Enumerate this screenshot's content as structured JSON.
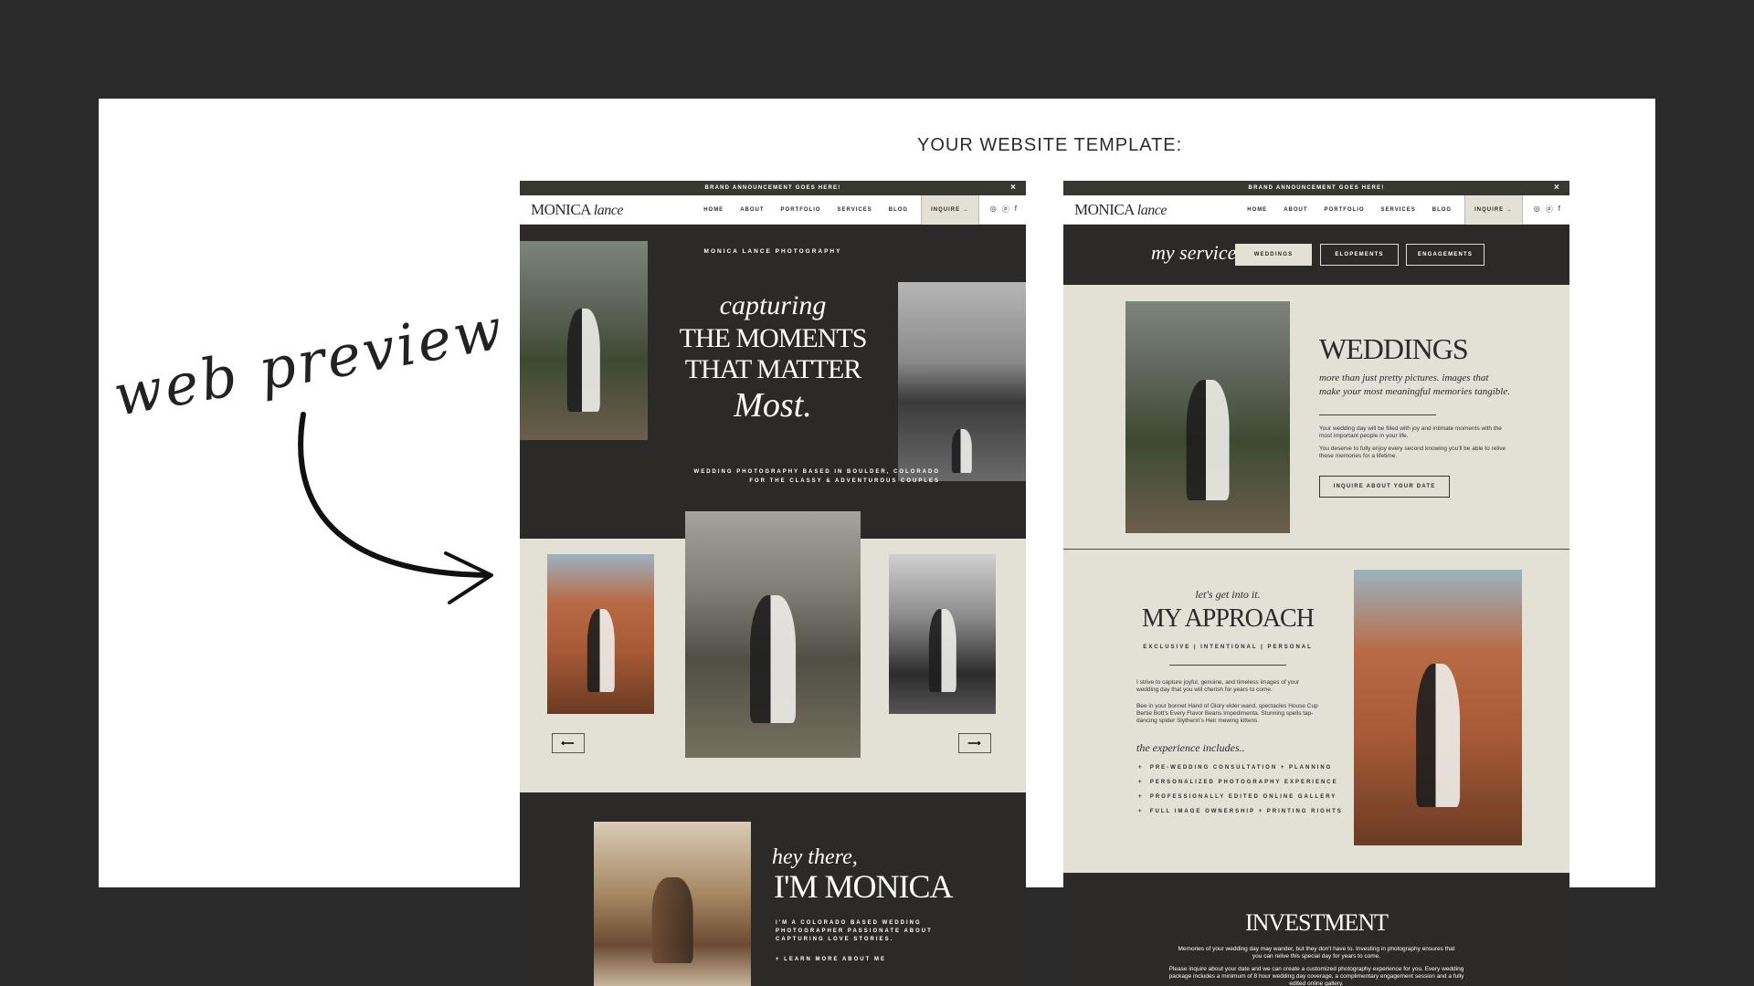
{
  "page": {
    "title": "YOUR WEBSITE TEMPLATE:",
    "side_label": "web preview"
  },
  "colors": {
    "background": "#2a2a2a",
    "sheet": "#ffffff",
    "dark": "#2b2a28",
    "cream": "#e3e0d6"
  },
  "mockup_left": {
    "announcement": "BRAND ANNOUNCEMENT GOES HERE!",
    "close": "×",
    "logo_main": "MONICA",
    "logo_script": "lance",
    "nav": [
      "HOME",
      "ABOUT",
      "PORTFOLIO",
      "SERVICES",
      "BLOG"
    ],
    "inquire": "INQUIRE →",
    "social": [
      "instagram-icon",
      "pinterest-icon",
      "facebook-icon"
    ],
    "hero": {
      "eyebrow": "MONICA LANCE PHOTOGRAPHY",
      "script_top": "capturing",
      "headline_1": "THE MOMENTS",
      "headline_2": "THAT MATTER",
      "script_bottom": "Most.",
      "tagline_1": "WEDDING PHOTOGRAPHY BASED IN BOULDER, COLORADO",
      "tagline_2": "FOR THE CLASSY & ADVENTUROUS COUPLES"
    },
    "gallery": {
      "prev": "⟵",
      "next": "⟶"
    },
    "about": {
      "script": "hey there,",
      "title": "I'M MONICA",
      "desc_1": "I'M A COLORADO BASED WEDDING",
      "desc_2": "PHOTOGRAPHER PASSIONATE ABOUT",
      "desc_3": "CAPTURING LOVE STORIES.",
      "link": "+ LEARN MORE ABOUT ME"
    }
  },
  "mockup_right": {
    "announcement": "BRAND ANNOUNCEMENT GOES HERE!",
    "close": "×",
    "logo_main": "MONICA",
    "logo_script": "lance",
    "nav": [
      "HOME",
      "ABOUT",
      "PORTFOLIO",
      "SERVICES",
      "BLOG"
    ],
    "inquire": "INQUIRE →",
    "services": {
      "script": "my services",
      "tabs": [
        "WEDDINGS",
        "ELOPEMENTS",
        "ENGAGEMENTS"
      ]
    },
    "weddings": {
      "title": "WEDDINGS",
      "sub_1": "more than just pretty pictures. images that",
      "sub_2": "make your most meaningful memories tangible.",
      "p1": "Your wedding day will be filled with joy and intimate moments with the most important people in your life.",
      "p2": "You deserve to fully enjoy every second knowing you'll be able to relive these memories for a lifetime.",
      "button": "INQUIRE ABOUT YOUR DATE"
    },
    "approach": {
      "script": "let's get into it.",
      "title": "MY APPROACH",
      "tags": "EXCLUSIVE | INTENTIONAL | PERSONAL",
      "p1": "I strive to capture joyful, genuine, and timeless images of your wedding day that you will cherish for years to come.",
      "p2": "Bee in your bonnet Hand of Glory elder wand, spectacles House Cup Bertie Bott's Every Flavor Beans Impedimenta. Stunning spells tap-dancing spider Slytherin's Heir mewing kittens",
      "exp_script": "the experience includes..",
      "list": [
        "PRE-WEDDING CONSULTATION + PLANNING",
        "PERSONALIZED PHOTOGRAPHY EXPERIENCE",
        "PROFESSIONALLY EDITED ONLINE GALLERY",
        "FULL IMAGE OWNERSHIP + PRINTING RIGHTS"
      ]
    },
    "investment": {
      "title": "INVESTMENT",
      "p1": "Memories of your wedding day may wander, but they don't have to. Investing in photography ensures that you can relive this special day for years to come.",
      "p2": "Please inquire about your date and we can create a customized photography experience for you. Every wedding package includes a minimum of 8 hour wedding day coverage, a complimentary engagement session and a fully edited online gallery."
    }
  }
}
